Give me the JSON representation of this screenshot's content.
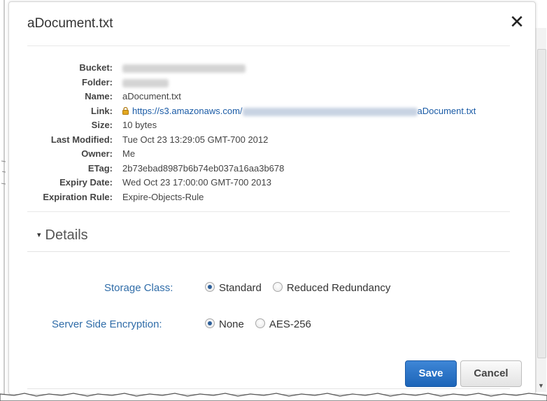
{
  "dialog": {
    "title": "aDocument.txt",
    "close_glyph": "✕"
  },
  "info": {
    "rows": [
      {
        "label": "Bucket:",
        "value": "",
        "redacted": true
      },
      {
        "label": "Folder:",
        "value": "",
        "redacted": true
      },
      {
        "label": "Name:",
        "value": "aDocument.txt"
      },
      {
        "label": "Link:",
        "value_prefix": "https://s3.amazonaws.com/",
        "value_suffix": "aDocument.txt",
        "is_link": true
      },
      {
        "label": "Size:",
        "value": "10 bytes"
      },
      {
        "label": "Last Modified:",
        "value": "Tue Oct 23 13:29:05 GMT-700 2012"
      },
      {
        "label": "Owner:",
        "value": "Me"
      },
      {
        "label": "ETag:",
        "value": "2b73ebad8987b6b74eb037a16aa3b678"
      },
      {
        "label": "Expiry Date:",
        "value": "Wed Oct 23 17:00:00 GMT-700 2013"
      },
      {
        "label": "Expiration Rule:",
        "value": "Expire-Objects-Rule"
      }
    ]
  },
  "details": {
    "header": "Details",
    "caret": "▾"
  },
  "storage_class": {
    "label": "Storage Class:",
    "options": [
      "Standard",
      "Reduced Redundancy"
    ],
    "selected": "Standard"
  },
  "encryption": {
    "label": "Server Side Encryption:",
    "options": [
      "None",
      "AES-256"
    ],
    "selected": "None"
  },
  "buttons": {
    "save": "Save",
    "cancel": "Cancel"
  },
  "icons": {
    "close": "close-icon",
    "lock": "lock-icon",
    "caret": "caret-down-icon"
  },
  "colors": {
    "link": "#1a5ba6",
    "field_label": "#2f6ca8",
    "save_button": "#1c64b8"
  }
}
